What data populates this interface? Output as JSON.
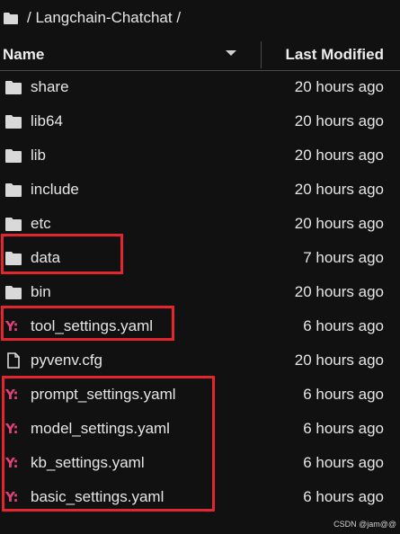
{
  "breadcrumb": {
    "icon": "folder-icon",
    "path": "/ Langchain-Chatchat /"
  },
  "header": {
    "name_label": "Name",
    "modified_label": "Last Modified",
    "sort_icon": "caret-down-icon"
  },
  "files": [
    {
      "name": "share",
      "modified": "20 hours ago",
      "icon": "folder-icon"
    },
    {
      "name": "lib64",
      "modified": "20 hours ago",
      "icon": "folder-icon"
    },
    {
      "name": "lib",
      "modified": "20 hours ago",
      "icon": "folder-icon"
    },
    {
      "name": "include",
      "modified": "20 hours ago",
      "icon": "folder-icon"
    },
    {
      "name": "etc",
      "modified": "20 hours ago",
      "icon": "folder-icon"
    },
    {
      "name": "data",
      "modified": "7 hours ago",
      "icon": "folder-icon"
    },
    {
      "name": "bin",
      "modified": "20 hours ago",
      "icon": "folder-icon"
    },
    {
      "name": "tool_settings.yaml",
      "modified": "6 hours ago",
      "icon": "yaml-file-icon"
    },
    {
      "name": "pyvenv.cfg",
      "modified": "20 hours ago",
      "icon": "file-icon"
    },
    {
      "name": "prompt_settings.yaml",
      "modified": "6 hours ago",
      "icon": "yaml-file-icon"
    },
    {
      "name": "model_settings.yaml",
      "modified": "6 hours ago",
      "icon": "yaml-file-icon"
    },
    {
      "name": "kb_settings.yaml",
      "modified": "6 hours ago",
      "icon": "yaml-file-icon"
    },
    {
      "name": "basic_settings.yaml",
      "modified": "6 hours ago",
      "icon": "yaml-file-icon"
    }
  ],
  "yaml_glyph": "Y:",
  "watermark": "CSDN @jam@@",
  "colors": {
    "background": "#111111",
    "highlight": "#e3262e",
    "yaml_icon": "#e0407a"
  }
}
